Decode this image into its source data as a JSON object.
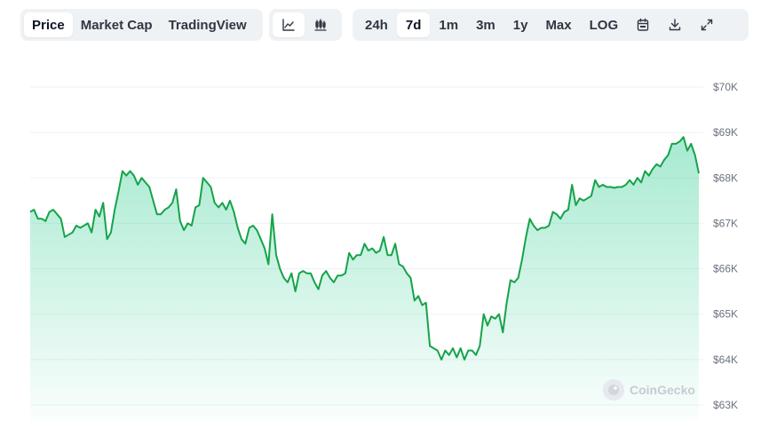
{
  "toolbar": {
    "metric_tabs": [
      {
        "label": "Price",
        "active": true
      },
      {
        "label": "Market Cap",
        "active": false
      },
      {
        "label": "TradingView",
        "active": false
      }
    ],
    "chart_type_buttons": [
      {
        "icon": "line-chart-icon",
        "active": true
      },
      {
        "icon": "candlestick-chart-icon",
        "active": false
      }
    ],
    "ranges": [
      {
        "label": "24h",
        "active": false
      },
      {
        "label": "7d",
        "active": true
      },
      {
        "label": "1m",
        "active": false
      },
      {
        "label": "3m",
        "active": false
      },
      {
        "label": "1y",
        "active": false
      },
      {
        "label": "Max",
        "active": false
      }
    ],
    "log_label": "LOG",
    "tool_icons": [
      "calendar-icon",
      "download-icon",
      "expand-icon"
    ]
  },
  "watermark": {
    "text": "CoinGecko"
  },
  "colors": {
    "line": "#16a34a",
    "fill_top": "#16c784",
    "grid": "#eff2f5",
    "active_bg": "#ffffff",
    "group_bg": "#eff2f5"
  },
  "chart_data": {
    "type": "area",
    "ylim": [
      63000,
      70000
    ],
    "yticks": [
      70000,
      69000,
      68000,
      67000,
      66000,
      65000,
      64000,
      63000
    ],
    "ytick_labels": [
      "$70K",
      "$69K",
      "$68K",
      "$67K",
      "$66K",
      "$65K",
      "$64K",
      "$63K"
    ],
    "grid": true,
    "x_range": "7d",
    "series": [
      {
        "values": [
          67250,
          67300,
          67100,
          67100,
          67050,
          67250,
          67300,
          67200,
          67100,
          66700,
          66750,
          66800,
          66950,
          66900,
          66950,
          67000,
          66800,
          67300,
          67150,
          67450,
          66650,
          66800,
          67300,
          67700,
          68150,
          68050,
          68150,
          68050,
          67850,
          68000,
          67900,
          67800,
          67500,
          67200,
          67200,
          67300,
          67350,
          67450,
          67750,
          67050,
          66850,
          67000,
          66950,
          67350,
          67400,
          68000,
          67900,
          67800,
          67450,
          67350,
          67450,
          67300,
          67500,
          67250,
          66900,
          66650,
          66550,
          66900,
          66950,
          66850,
          66650,
          66450,
          66100,
          67200,
          66300,
          66000,
          65800,
          65700,
          65900,
          65500,
          65900,
          65950,
          65900,
          65900,
          65700,
          65550,
          65850,
          65950,
          65800,
          65700,
          65850,
          65850,
          65900,
          66350,
          66200,
          66300,
          66300,
          66550,
          66400,
          66450,
          66350,
          66400,
          66700,
          66300,
          66300,
          66550,
          66100,
          66050,
          65900,
          65800,
          65300,
          65400,
          65200,
          65250,
          64300,
          64250,
          64200,
          64000,
          64200,
          64100,
          64250,
          64050,
          64250,
          64000,
          64200,
          64200,
          64100,
          64300,
          65000,
          64750,
          64950,
          64900,
          65000,
          64600,
          65250,
          65750,
          65700,
          65800,
          66200,
          66700,
          67100,
          66950,
          66850,
          66900,
          66900,
          66950,
          67250,
          67200,
          67100,
          67250,
          67300,
          67850,
          67400,
          67550,
          67500,
          67550,
          67600,
          67950,
          67800,
          67850,
          67800,
          67800,
          67780,
          67800,
          67800,
          67850,
          67950,
          67850,
          68000,
          67900,
          68150,
          68050,
          68200,
          68300,
          68250,
          68400,
          68500,
          68750,
          68750,
          68800,
          68900,
          68600,
          68750,
          68500,
          68100
        ]
      }
    ]
  }
}
